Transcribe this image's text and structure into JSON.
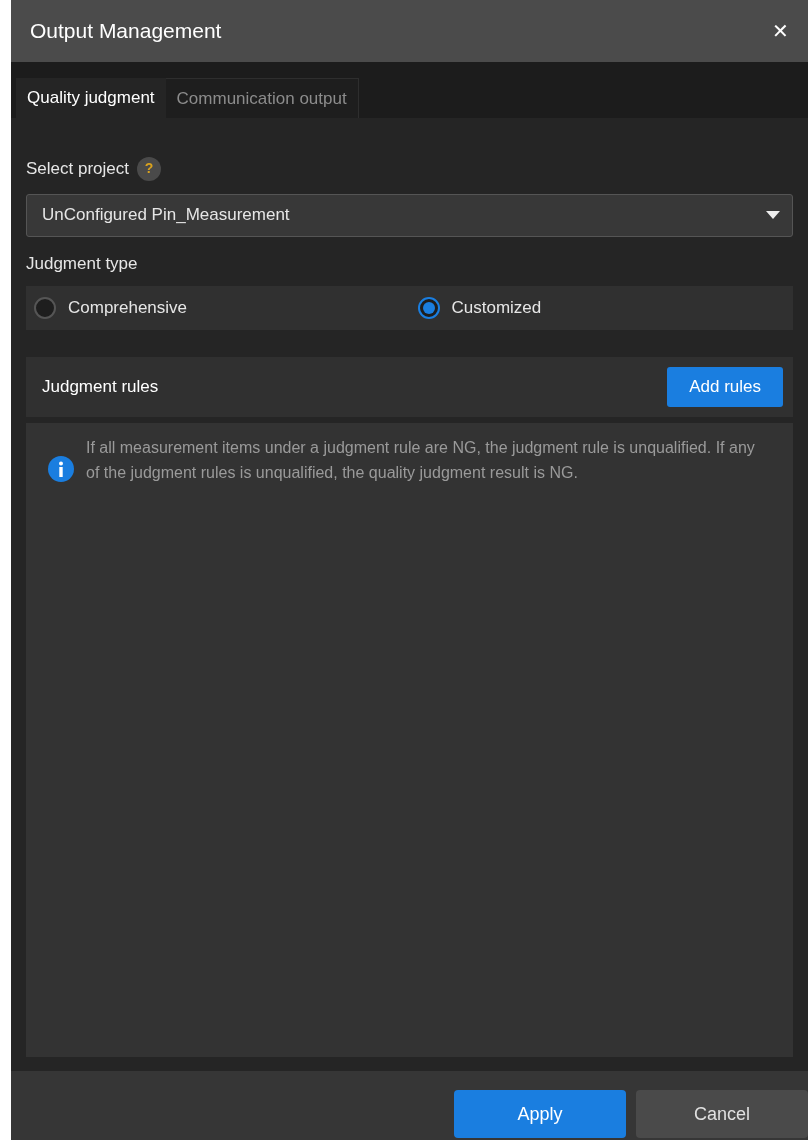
{
  "window": {
    "title": "Output Management",
    "close": "✕"
  },
  "tabs": [
    {
      "label": "Quality judgment",
      "selected": true
    },
    {
      "label": "Communication output",
      "selected": false
    }
  ],
  "select_project": {
    "label": "Select project",
    "help": "?",
    "value": "UnConfigured Pin_Measurement"
  },
  "judgment_type": {
    "label": "Judgment type",
    "options": [
      {
        "label": "Comprehensive",
        "selected": false
      },
      {
        "label": "Customized",
        "selected": true
      }
    ]
  },
  "judgment_rules": {
    "title": "Judgment rules",
    "add_button": "Add rules",
    "info": "If all measurement items under a judgment rule are NG, the judgment rule is unqualified. If any of the judgment rules is unqualified, the quality judgment result is NG."
  },
  "buttons": [
    {
      "label": "Apply",
      "kind": "primary"
    },
    {
      "label": "Cancel",
      "kind": "secondary"
    }
  ]
}
